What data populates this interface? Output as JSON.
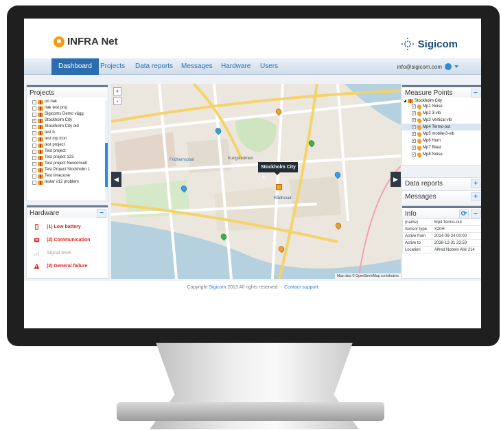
{
  "app": {
    "title": "INFRA Net",
    "brand": "Sigicom"
  },
  "nav": {
    "tabs": [
      "Dashboard",
      "Projects",
      "Data reports",
      "Messages",
      "Hardware",
      "Users"
    ],
    "active_tab": "Dashboard",
    "user_email": "info@sigicom.com"
  },
  "projects": {
    "title": "Projects",
    "items": [
      {
        "label": "on riak",
        "checked": false
      },
      {
        "label": "riak test proj",
        "checked": false
      },
      {
        "label": "Sigicoms Demo vägg",
        "checked": false
      },
      {
        "label": "Stockholm City",
        "checked": true
      },
      {
        "label": "Stockholm City old",
        "checked": false
      },
      {
        "label": "test b",
        "checked": false
      },
      {
        "label": "test mp icon",
        "checked": false
      },
      {
        "label": "test project",
        "checked": false
      },
      {
        "label": "Test project",
        "checked": false
      },
      {
        "label": "Test project 123",
        "checked": false
      },
      {
        "label": "Test project Nexconsult",
        "checked": false
      },
      {
        "label": "Test Project Stockholm 1",
        "checked": false
      },
      {
        "label": "Test timezone",
        "checked": false
      },
      {
        "label": "testar v12 problem",
        "checked": false
      }
    ]
  },
  "hardware": {
    "title": "Hardware",
    "items": [
      {
        "label": "(1) Low battery",
        "icon": "battery-icon",
        "alert": true
      },
      {
        "label": "(2) Communication",
        "icon": "communication-icon",
        "alert": true
      },
      {
        "label": "Signal level",
        "icon": "signal-icon",
        "alert": false
      },
      {
        "label": "(2) General failure",
        "icon": "warning-icon",
        "alert": true
      }
    ]
  },
  "map": {
    "zoom_in": "+",
    "zoom_out": "-",
    "popup": "Stockholm City",
    "popup_close": "×",
    "attribution": "Map data © OpenStreetMap contributors",
    "labels": [
      "Kungsholmen",
      "Rådhuset",
      "Fridhemsplan",
      "Stockholm City"
    ]
  },
  "measure_points": {
    "title": "Measure Points",
    "project": "Stockholm City",
    "items": [
      {
        "label": "Mp1 Noise",
        "selected": false
      },
      {
        "label": "Mp2 3-vib",
        "selected": false
      },
      {
        "label": "Mp3 Vertical vib",
        "selected": false
      },
      {
        "label": "Mp4 Termo-out",
        "selected": true
      },
      {
        "label": "Mp5 mobile-3-vib",
        "selected": false
      },
      {
        "label": "Mp6 Hum",
        "selected": false
      },
      {
        "label": "Mp7 Blast",
        "selected": false
      },
      {
        "label": "Mp8 Noise",
        "selected": false
      }
    ]
  },
  "data_reports": {
    "title": "Data reports"
  },
  "messages": {
    "title": "Messages"
  },
  "info": {
    "title": "Info",
    "rows": [
      [
        "(name)",
        "Mp4 Termo-out"
      ],
      [
        "Sensor type",
        "X20H"
      ],
      [
        "Active from",
        "2014-09-24 00:00"
      ],
      [
        "Active to",
        "2038-12-31 23:59"
      ],
      [
        "Location",
        "Alfred Nobels Allé 214"
      ]
    ]
  },
  "footer": {
    "copyright_prefix": "Copyright",
    "company": "Sigicom",
    "copyright_suffix": "2013 All rights reserved",
    "support": "Contact support"
  },
  "colors": {
    "accent": "#2c6db0",
    "alert": "#d9231f",
    "logo": "#f39c12",
    "bezel": "#1f1f1f"
  }
}
